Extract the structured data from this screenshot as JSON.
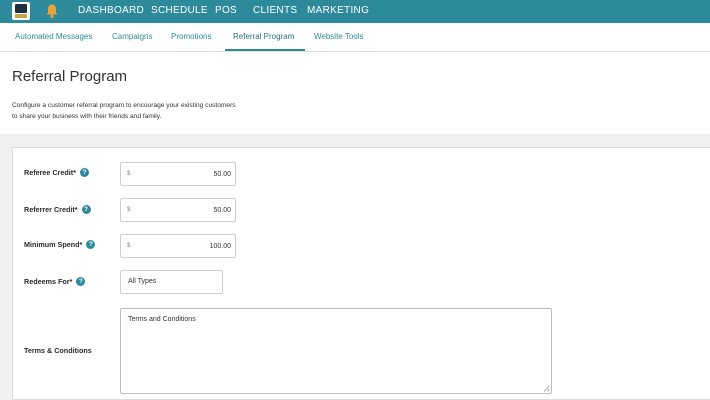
{
  "topnav": {
    "items": [
      "DASHBOARD",
      "SCHEDULE",
      "POS",
      "CLIENTS",
      "MARKETING"
    ]
  },
  "subnav": {
    "tabs": [
      "Automated Messages",
      "Campaigns",
      "Promotions",
      "Referral Program",
      "Website Tools"
    ],
    "active_tab": "Referral Program"
  },
  "page": {
    "title": "Referral Program",
    "description_line1": "Configure a customer referral program to encourage your existing customers",
    "description_line2": "to share your business with their friends and family."
  },
  "form": {
    "currency_symbol": "$",
    "help_glyph": "?",
    "referee_credit": {
      "label": "Referee Credit*",
      "value": "50.00"
    },
    "referrer_credit": {
      "label": "Referrer Credit*",
      "value": "50.00"
    },
    "minimum_spend": {
      "label": "Minimum Spend*",
      "value": "100.00"
    },
    "redeems_for": {
      "label": "Redeems For*",
      "value": "All Types"
    },
    "terms": {
      "label": "Terms & Conditions",
      "value": "Terms and Conditions"
    }
  },
  "colors": {
    "brand_teal": "#2d8a9b",
    "band_gray": "#f0f0f0"
  },
  "icons": {
    "logo": "business-logo",
    "bell": "bell-icon",
    "help": "help-icon"
  }
}
